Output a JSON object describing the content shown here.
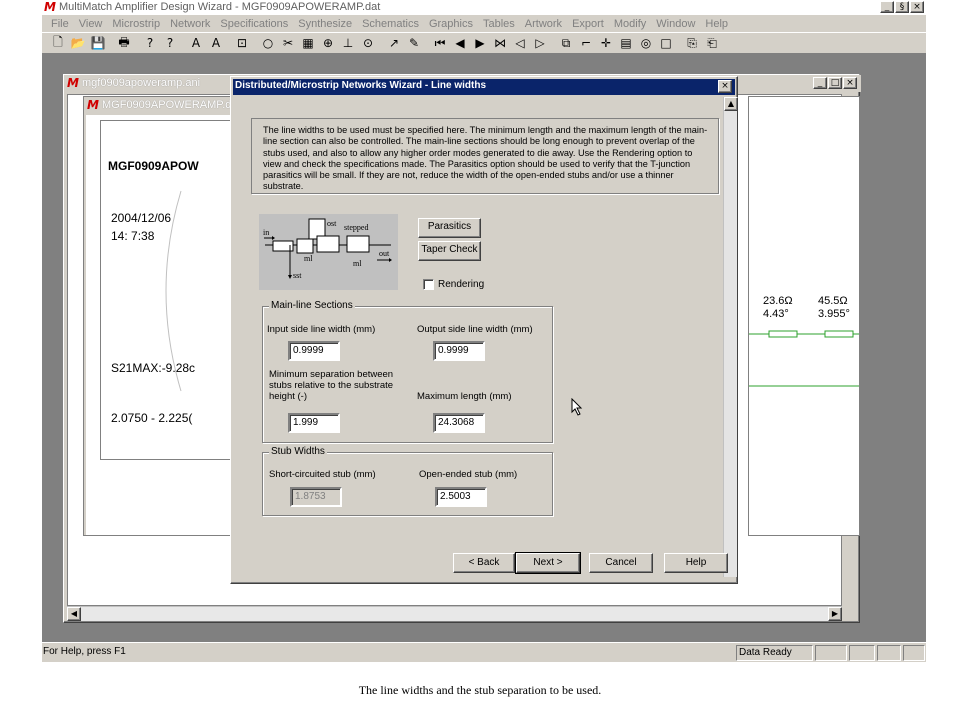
{
  "app": {
    "logo": "M",
    "title": "MultiMatch Amplifier Design Wizard - MGF0909APOWERAMP.dat",
    "caption_buttons": [
      "_",
      "§",
      "×"
    ]
  },
  "menu": [
    "File",
    "View",
    "Microstrip",
    "Network",
    "Specifications",
    "Synthesize",
    "Schematics",
    "Graphics",
    "Tables",
    "Artwork",
    "Export",
    "Modify",
    "Window",
    "Help"
  ],
  "toolbar": {
    "icons": [
      "new-file-icon",
      "open-folder-icon",
      "save-disk-icon",
      "print-icon",
      "help-question-icon",
      "context-help-icon",
      "font-a-icon",
      "font-a-bold-icon",
      "cursor-box-icon",
      "circle-icon",
      "scissors-icon",
      "grid-icon",
      "component-icon",
      "tree-icon",
      "target-icon",
      "arrow-icon",
      "pen-icon",
      "first-icon",
      "previous-icon",
      "play-back-icon",
      "stop-icon",
      "step-back-icon",
      "step-forward-icon",
      "copy-icon",
      "corner-icon",
      "cross-icon",
      "table-icon",
      "radio-icon",
      "stop-square-icon",
      "export-icon",
      "import-icon"
    ],
    "glyphs": [
      "🗋",
      "📂",
      "💾",
      "🖶",
      "?",
      "?",
      "A",
      "A",
      "⊡",
      "○",
      "✂",
      "▦",
      "⊕",
      "⊥",
      "⊙",
      "↗",
      "✎",
      "⏮",
      "◀",
      "▶",
      "⋈",
      "◁",
      "▷",
      "⧉",
      "⌐",
      "✛",
      "▤",
      "◎",
      "□",
      "⎘",
      "⎗"
    ]
  },
  "child_windows": {
    "ani_title": "mgf0909apoweramp.ani",
    "dat_title": "MGF0909APOWERAMP.dat",
    "doc": {
      "header": "MGF0909APOW",
      "date": "2004/12/06",
      "time": "14: 7:38",
      "s21": "S21MAX:-9.28c",
      "band": "2.0750 - 2.225("
    },
    "right_view": {
      "col1": [
        "23.6Ω",
        "4.43°"
      ],
      "col2": [
        "45.5Ω",
        "3.955°"
      ]
    }
  },
  "dialog": {
    "title": "Distributed/Microstrip Networks Wizard - Line widths",
    "info_text": "The line widths to be used must be specified here. The minimum length and the maximum length of the main-line section can also be controlled. The main-line sections should be long enough to prevent overlap of the stubs used, and also to allow any higher order modes generated to die away. Use the Rendering option to view and check the specifications made. The Parasitics option should be used to verify that the T-junction parasitics will be small.  If they are not, reduce the width of the open-ended stubs and/or use a thinner substrate.",
    "diagram_labels": {
      "in": "in",
      "ost": "ost",
      "stepped": "stepped",
      "ml_left": "ml",
      "ml_right": "ml",
      "out": "out",
      "sst": "sst"
    },
    "parasitics_label": "Parasitics",
    "taper_check_label": "Taper Check",
    "rendering_label": "Rendering",
    "rendering_checked": false,
    "main_line": {
      "legend": "Main-line Sections",
      "input_width_label": "Input side line width (mm)",
      "input_width_value": "0.9999",
      "output_width_label": "Output side line width (mm)",
      "output_width_value": "0.9999",
      "min_sep_label_1": "Minimum separation between",
      "min_sep_label_2": "stubs relative to the substrate",
      "min_sep_label_3": "height (-)",
      "min_sep_value": "1.999",
      "max_len_label": "Maximum length (mm)",
      "max_len_value": "24.3068"
    },
    "stubs": {
      "legend": "Stub Widths",
      "short_label": "Short-circuited stub (mm)",
      "short_value": "1.8753",
      "open_label": "Open-ended stub (mm)",
      "open_value": "2.5003"
    },
    "buttons": {
      "back": "< Back",
      "next": "Next >",
      "cancel": "Cancel",
      "help": "Help"
    }
  },
  "status": {
    "left": "For Help, press F1",
    "right": "Data Ready"
  },
  "caption": "The line widths and the stub separation to be used."
}
